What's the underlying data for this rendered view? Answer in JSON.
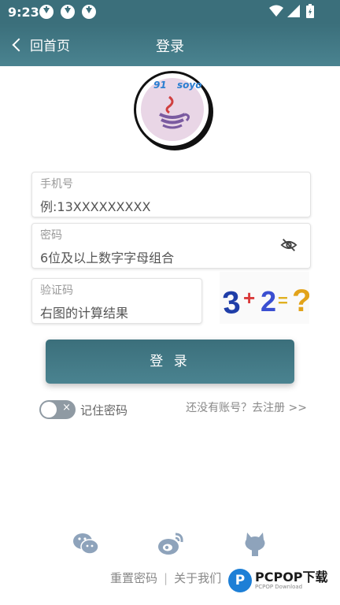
{
  "status_bar": {
    "time": "9:23"
  },
  "header": {
    "back_label": "回首页",
    "title": "登录"
  },
  "logo": {
    "text_left": "91",
    "text_right": "soyo"
  },
  "form": {
    "phone": {
      "label": "手机号",
      "placeholder": "例:13XXXXXXXXX"
    },
    "password": {
      "label": "密码",
      "placeholder": "6位及以上数字字母组合"
    },
    "captcha": {
      "label": "验证码",
      "placeholder": "右图的计算结果",
      "image_text": "3+2=?"
    }
  },
  "login_button": "登 录",
  "remember": {
    "label": "记住密码",
    "checked": false
  },
  "register_link": "还没有账号？去注册 >>",
  "social": [
    "wechat-icon",
    "weibo-icon",
    "github-icon"
  ],
  "footer": {
    "reset_password": "重置密码",
    "separator": "|",
    "about": "关于我们"
  },
  "watermark": {
    "brand": "PCPOP下载",
    "sub": "PCPOP Download"
  },
  "colors": {
    "primary": "#3b6f7b",
    "icon": "#8ea3bb"
  }
}
